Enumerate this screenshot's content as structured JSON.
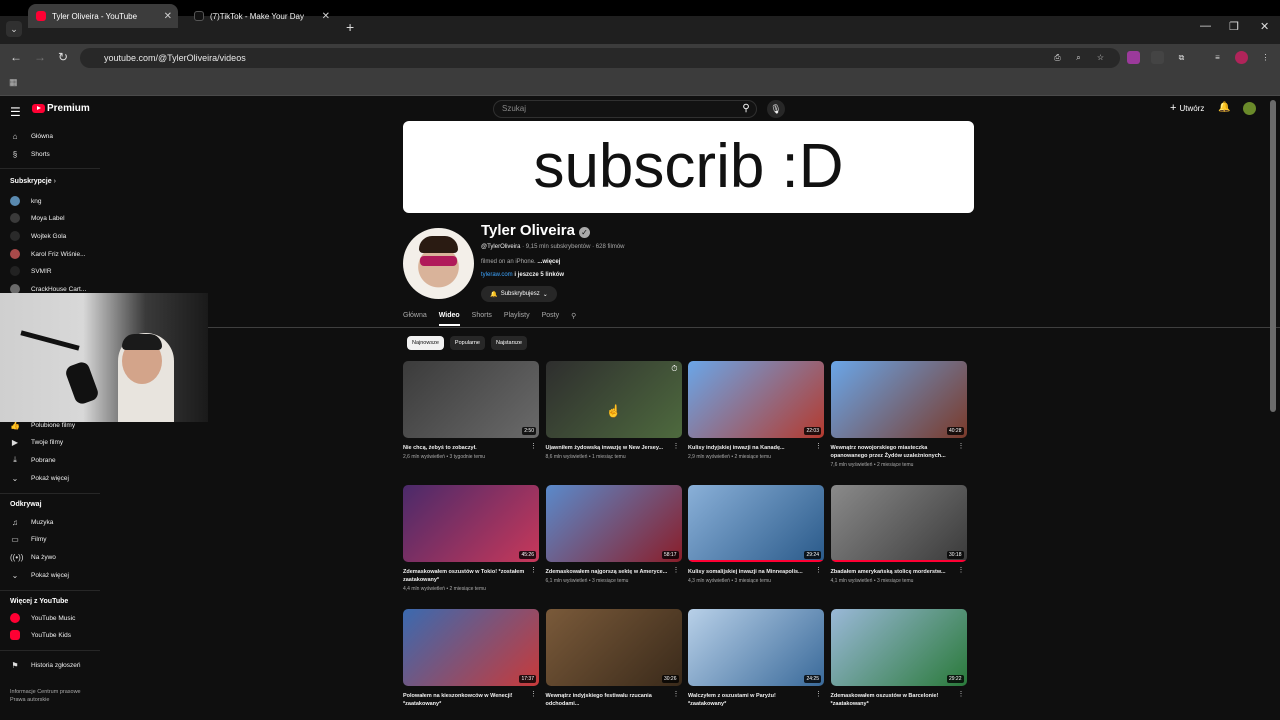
{
  "browser": {
    "tabs": [
      {
        "title": "Tyler Oliveira - YouTube",
        "active": true
      },
      {
        "title": "(7)TikTok - Make Your Day",
        "active": false
      }
    ],
    "url": "youtube.com/@TylerOliveira/videos"
  },
  "masthead": {
    "logo": "Premium",
    "search_placeholder": "Szukaj",
    "create_label": "Utwórz"
  },
  "sidebar": {
    "main": [
      {
        "label": "Główna",
        "icon": "home-icon"
      },
      {
        "label": "Shorts",
        "icon": "shorts-icon"
      }
    ],
    "subs_header": "Subskrypcje",
    "subscriptions": [
      {
        "label": "kng"
      },
      {
        "label": "Moya Label"
      },
      {
        "label": "Wojtek Gola"
      },
      {
        "label": "Karol Friz Wiśnie..."
      },
      {
        "label": "SVM!R"
      },
      {
        "label": "CrackHouse Cart..."
      }
    ],
    "you": [
      {
        "label": "Polubione filmy",
        "icon": "thumb-up-icon"
      },
      {
        "label": "Twoje filmy",
        "icon": "video-icon"
      },
      {
        "label": "Pobrane",
        "icon": "download-icon"
      },
      {
        "label": "Pokaż więcej",
        "icon": "chevron-down-icon"
      }
    ],
    "explore_header": "Odkrywaj",
    "explore": [
      {
        "label": "Muzyka",
        "icon": "music-icon"
      },
      {
        "label": "Filmy",
        "icon": "film-icon"
      },
      {
        "label": "Na żywo",
        "icon": "live-icon"
      },
      {
        "label": "Pokaż więcej",
        "icon": "chevron-down-icon"
      }
    ],
    "more_header": "Więcej z YouTube",
    "more": [
      {
        "label": "YouTube Music"
      },
      {
        "label": "YouTube Kids"
      }
    ],
    "report": "Historia zgłoszeń",
    "footer1": "Informacje  Centrum prasowe",
    "footer2": "Prawa autorskie"
  },
  "channel": {
    "banner_text": "subscrib :D",
    "name": "Tyler Oliveira",
    "handle": "@TylerOliveira",
    "subs": "· 9,15 mln subskrybentów · 628 filmów",
    "desc": "filmed on an iPhone.",
    "desc_more": "...więcej",
    "link": "tyleraw.com",
    "link_more": " i jeszcze 5 linków",
    "subscribed": "Subskrybujesz"
  },
  "tabs": [
    "Główna",
    "Wideo",
    "Shorts",
    "Playlisty",
    "Posty"
  ],
  "chips": [
    "Najnowsze",
    "Popularne",
    "Najstarsze"
  ],
  "videos": [
    {
      "title": "Nie chcą, żebyś to zobaczył.",
      "meta": "2,6 mln wyświetleń • 3 tygodnie temu",
      "dur": "2:50",
      "progress": 0,
      "colors": [
        "#3b3b3b",
        "#6a6a6a"
      ]
    },
    {
      "title": "Ujawniłem żydowską inwazję w New Jersey...",
      "meta": "8,6 mln wyświetleń • 1 miesiąc temu",
      "dur": "",
      "progress": 0,
      "colors": [
        "#2e2e2e",
        "#4e6a3e"
      ]
    },
    {
      "title": "Kulisy indyjskiej inwazji na Kanadę...",
      "meta": "2,9 mln wyświetleń • 2 miesiące temu",
      "dur": "22:03",
      "progress": 0,
      "colors": [
        "#6aa6e8",
        "#b43a2e"
      ]
    },
    {
      "title": "Wewnątrz nowojorskiego miasteczka opanowanego przez Żydów uzależnionych...",
      "meta": "7,6 mln wyświetleń • 2 miesiące temu",
      "dur": "40:28",
      "progress": 0,
      "colors": [
        "#6aa6e8",
        "#7a3a2a"
      ]
    },
    {
      "title": "Zdemaskowałem oszustów w Tokio! *zostałem zaatakowany*",
      "meta": "4,4 mln wyświetleń • 2 miesiące temu",
      "dur": "45:26",
      "progress": 0,
      "colors": [
        "#4a2a6a",
        "#c8385a"
      ]
    },
    {
      "title": "Zdemaskowałem najgorszą sektę w Ameryce...",
      "meta": "6,1 mln wyświetleń • 3 miesiące temu",
      "dur": "58:17",
      "progress": 0,
      "colors": [
        "#5a8acb",
        "#8a1e2a"
      ]
    },
    {
      "title": "Kulisy somalijskiej inwazji na Minneapolis...",
      "meta": "4,3 mln wyświetleń • 3 miesiące temu",
      "dur": "29:24",
      "progress": 100,
      "colors": [
        "#8ab0d8",
        "#2a5a8a"
      ]
    },
    {
      "title": "Zbadałem amerykańską stolicę morderstw...",
      "meta": "4,1 mln wyświetleń • 3 miesiące temu",
      "dur": "30:18",
      "progress": 100,
      "colors": [
        "#8a8a8a",
        "#3a3a3a"
      ]
    },
    {
      "title": "Polowałem na kieszonkowców w Wenecji! *zaatakowany*",
      "meta": "",
      "dur": "17:37",
      "progress": 0,
      "colors": [
        "#3a6ab0",
        "#c83a3a"
      ]
    },
    {
      "title": "Wewnątrz indyjskiego festiwalu rzucania odchodami...",
      "meta": "",
      "dur": "30:26",
      "progress": 0,
      "colors": [
        "#7a5a3a",
        "#3a2a1a"
      ]
    },
    {
      "title": "Walczyłem z oszustami w Paryżu! *zaatakowany*",
      "meta": "",
      "dur": "24:25",
      "progress": 0,
      "colors": [
        "#b8d0e8",
        "#3a6a9a"
      ]
    },
    {
      "title": "Zdemaskowałem oszustów w Barcelonie! *zaatakowany*",
      "meta": "",
      "dur": "29:22",
      "progress": 0,
      "colors": [
        "#9ab8d8",
        "#2a7a3a"
      ]
    }
  ]
}
